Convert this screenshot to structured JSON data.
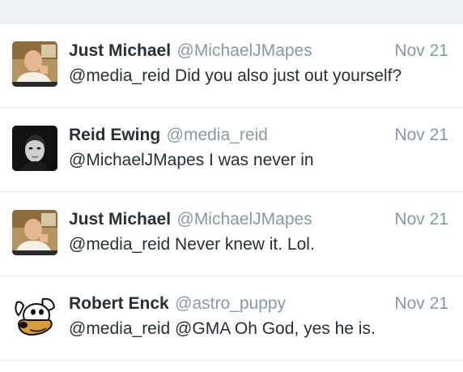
{
  "tweets": [
    {
      "name": "Just Michael",
      "handle": "@MichaelJMapes",
      "date": "Nov 21",
      "text": "@media_reid Did you also just out yourself?",
      "avatar": "photo-man-at-desk"
    },
    {
      "name": "Reid Ewing",
      "handle": "@media_reid",
      "date": "Nov 21",
      "text": "@MichaelJMapes I was never in",
      "avatar": "photo-bw-portrait"
    },
    {
      "name": "Just Michael",
      "handle": "@MichaelJMapes",
      "date": "Nov 21",
      "text": "@media_reid Never knew it. Lol.",
      "avatar": "photo-man-at-desk"
    },
    {
      "name": "Robert Enck",
      "handle": "@astro_puppy",
      "date": "Nov 21",
      "text": "@media_reid @GMA Oh God, yes he is.",
      "avatar": "cartoon-dog"
    }
  ],
  "colors": {
    "name": "#292f33",
    "secondary": "#8899a6",
    "divider": "#e1e6ea",
    "background": "#eef2f6"
  }
}
